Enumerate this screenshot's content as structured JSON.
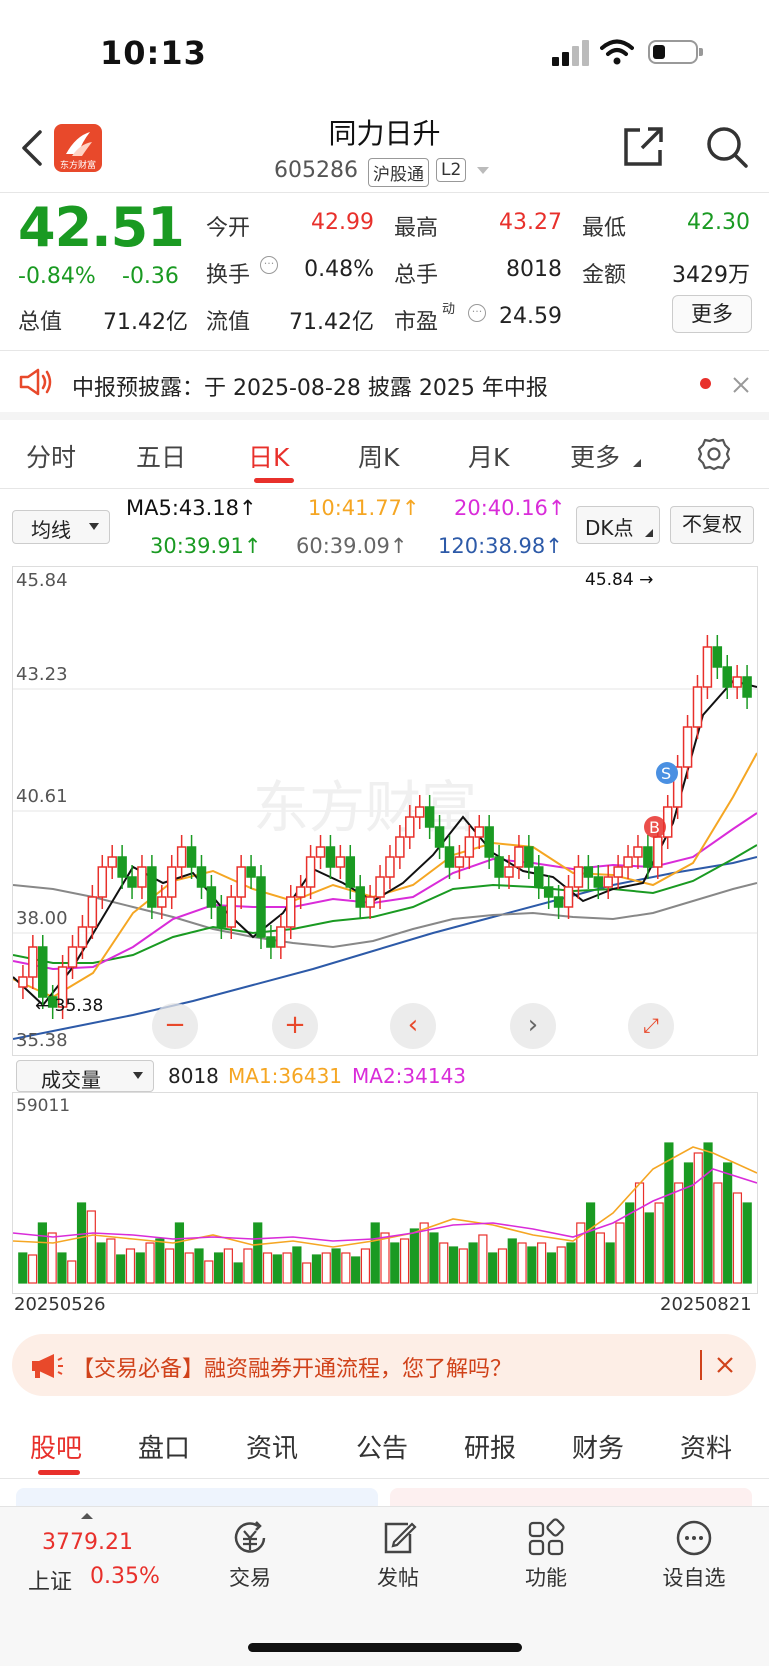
{
  "status": {
    "time": "10:13"
  },
  "header": {
    "title": "同力日升",
    "code": "605286",
    "tag_market": "沪股通",
    "tag_level": "L2",
    "logo_text": "东方财富"
  },
  "quote": {
    "price": "42.51",
    "change_pct": "-0.84%",
    "change": "-0.36",
    "open_label": "今开",
    "open": "42.99",
    "high_label": "最高",
    "high": "43.27",
    "low_label": "最低",
    "low": "42.30",
    "turnover_label": "换手",
    "turnover": "0.48%",
    "volume_label": "总手",
    "volume": "8018",
    "amount_label": "金额",
    "amount": "3429万",
    "mktcap_label": "总值",
    "mktcap": "71.42亿",
    "float_label": "流值",
    "float": "71.42亿",
    "pe_label": "市盈",
    "pe_sup": "动",
    "pe": "24.59",
    "more": "更多"
  },
  "notice": {
    "text": "中报预披露：于 2025-08-28 披露 2025 年中报"
  },
  "ktabs": [
    "分时",
    "五日",
    "日K",
    "周K",
    "月K",
    "更多"
  ],
  "ma": {
    "selector": "均线",
    "ma5": "MA5:43.18",
    "ma10": "10:41.77",
    "ma20": "20:40.16",
    "ma30": "30:39.91",
    "ma60": "60:39.09",
    "ma120": "120:38.98",
    "dk": "DK点",
    "fq": "不复权"
  },
  "chart": {
    "labels": [
      "45.84",
      "43.23",
      "40.61",
      "38.00",
      "35.38"
    ],
    "high_marker": "45.84",
    "low_marker": "35.38",
    "watermark": "东方财富",
    "signal_s": "S",
    "signal_b": "B"
  },
  "volume": {
    "selector": "成交量",
    "value": "8018",
    "ma1": "MA1:36431",
    "ma2": "MA2:34143",
    "max_label": "59011",
    "date_start": "20250526",
    "date_end": "20250821"
  },
  "banner": {
    "text": "【交易必备】融资融券开通流程，您了解吗？"
  },
  "btabs": [
    "股吧",
    "盘口",
    "资讯",
    "公告",
    "研报",
    "财务",
    "资料"
  ],
  "nav": {
    "index_value": "3779.21",
    "index_name": "上证",
    "index_change": "0.35%",
    "trade": "交易",
    "post": "发帖",
    "func": "功能",
    "watch": "设自选"
  },
  "colors": {
    "up": "#e8302b",
    "down": "#1a9a22",
    "ma5": "#111111",
    "ma10": "#f5a623",
    "ma20": "#d92cd9",
    "ma30": "#1a9a22",
    "ma60": "#888888",
    "ma120": "#2d5aa8"
  }
}
